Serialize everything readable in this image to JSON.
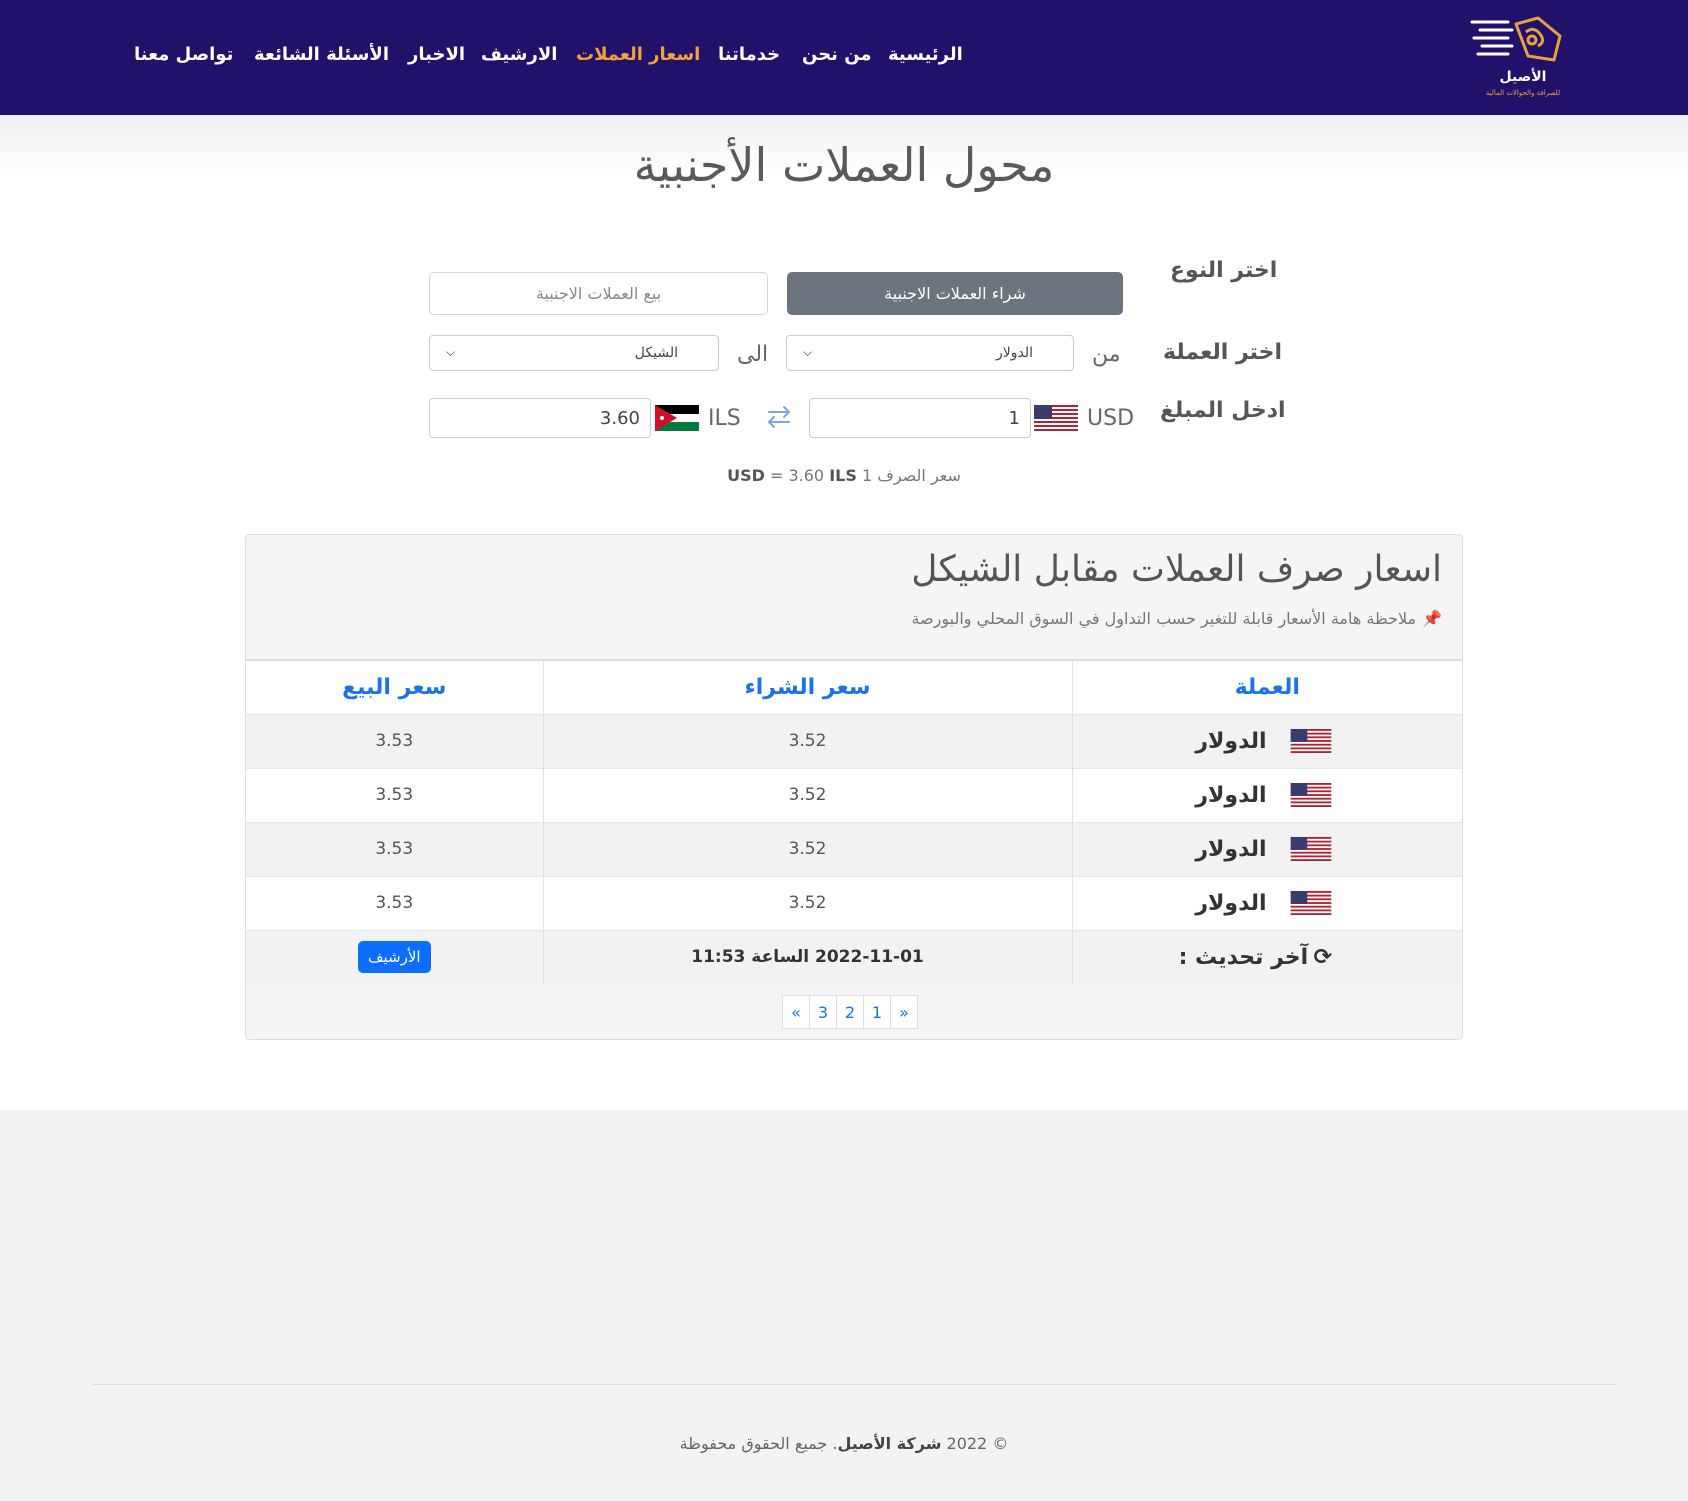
{
  "header": {
    "logo": {
      "name": "الأصيل",
      "tagline": "للصرافة والحوالات المالية"
    },
    "nav": [
      {
        "label": "الرئيسية"
      },
      {
        "label": "من نحن"
      },
      {
        "label": "خدماتنا"
      },
      {
        "label": "اسعار العملات",
        "active": true
      },
      {
        "label": "الارشيف"
      },
      {
        "label": "الاخبار"
      },
      {
        "label": "الأسئلة الشائعة"
      },
      {
        "label": "تواصل معنا"
      }
    ],
    "colors": {
      "background": "#22116b",
      "active": "#f2a23a"
    }
  },
  "converter": {
    "title": "محول العملات الأجنبية",
    "type_label": "اختر النوع",
    "buy_label": "شراء العملات الاجنبية",
    "sell_label": "بيع العملات الاجنبية",
    "currency_label": "اختر العملة",
    "from_label": "من",
    "from_value": "الدولار",
    "to_label": "الى",
    "to_value": "الشيكل",
    "amount_label": "ادخل المبلغ",
    "from_code": "USD",
    "from_amount": "1",
    "to_code": "ILS",
    "to_amount": "3.60",
    "rate_prefix": "سعر الصرف 1",
    "rate_from": "USD",
    "rate_eq": "= 3.60",
    "rate_to": "ILS"
  },
  "rates_panel": {
    "title": "اسعار صرف العملات مقابل الشيكل",
    "note": "ملاحظة هامة الأسعار قابلة للتغير حسب التداول في السوق المحلي والبورصة",
    "columns": {
      "currency": "العملة",
      "buy": "سعر الشراء",
      "sell": "سعر البيع"
    },
    "rows": [
      {
        "currency": "الدولار",
        "buy": "3.52",
        "sell": "3.53"
      },
      {
        "currency": "الدولار",
        "buy": "3.52",
        "sell": "3.53"
      },
      {
        "currency": "الدولار",
        "buy": "3.52",
        "sell": "3.53"
      },
      {
        "currency": "الدولار",
        "buy": "3.52",
        "sell": "3.53"
      }
    ],
    "last_update_label": "آخر تحديث :",
    "last_update_value": "2022-11-01 الساعة 11:53",
    "archive_button": "الأرشيف",
    "pagination": [
      "«",
      "3",
      "2",
      "1",
      "»"
    ]
  },
  "footer": {
    "prefix": "© 2022",
    "company": "شركة الأصيل",
    "suffix": ". جميع الحقوق محفوظة"
  }
}
